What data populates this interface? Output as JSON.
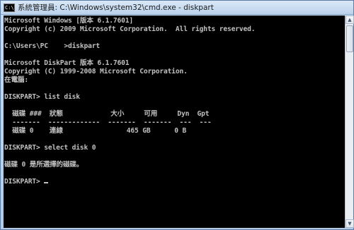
{
  "window": {
    "title": "系統管理員: C:\\Windows\\system32\\cmd.exe - diskpart",
    "icon_text": "C:\\"
  },
  "console": {
    "lines": [
      "Microsoft Windows [版本 6.1.7601]",
      "Copyright (c) 2009 Microsoft Corporation.  All rights reserved.",
      "",
      "C:\\Users\\PC    >diskpart",
      "",
      "Microsoft DiskPart 版本 6.1.7601",
      "Copyright (C) 1999-2008 Microsoft Corporation.",
      "在電腦:",
      "",
      "DISKPART> list disk",
      "",
      "  磁碟 ###  狀態            大小     可用     Dyn  Gpt",
      "  -------  -------------  -------  -------  ---  ---",
      "  磁碟 0    連線                465 GB      0 B",
      "",
      "DISKPART> select disk 0",
      "",
      "磁碟 0 是所選擇的磁碟。",
      "",
      "DISKPART> "
    ]
  },
  "scrollbar": {
    "up_icon": "scroll-up-arrow-icon",
    "down_icon": "scroll-down-arrow-icon"
  }
}
